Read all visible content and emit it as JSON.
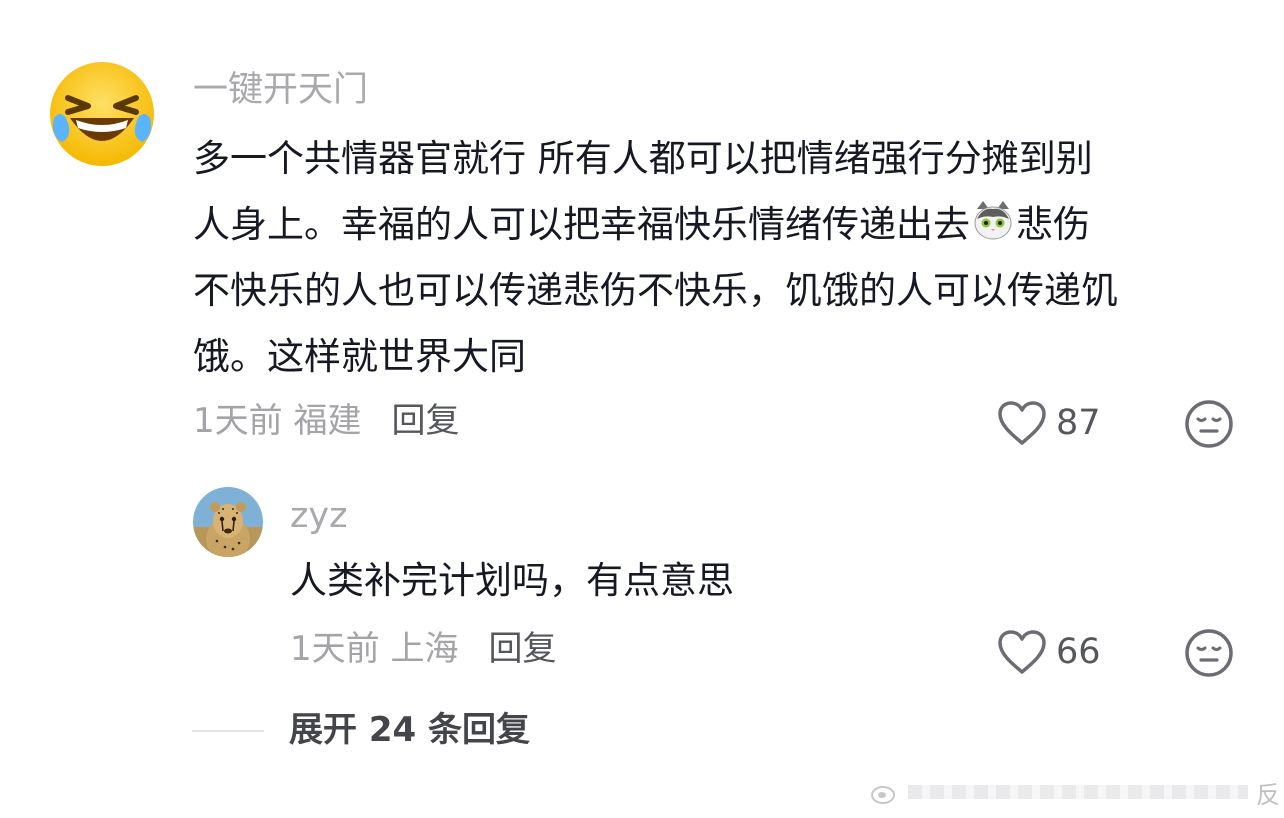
{
  "comment": {
    "username": "一键开天门",
    "text_lines": [
      "多一个共情器官就行  所有人都可以把情绪强行分摊到别",
      "人身上。幸福的人可以把幸福快乐情绪传递出去",
      "悲伤",
      "不快乐的人也可以传递悲伤不快乐，饥饿的人可以传递饥",
      "饿。这样就世界大同"
    ],
    "inline_emoji": "cat-emoji",
    "time_location": "1天前 福建",
    "reply_label": "回复",
    "likes": "87",
    "avatar": "laughing-crying-emoji"
  },
  "reply": {
    "username": "zyz",
    "text": "人类补完计划吗，有点意思",
    "time_location": "1天前 上海",
    "reply_label": "回复",
    "likes": "66",
    "avatar": "cheetah-photo"
  },
  "expand": {
    "label": "展开 24 条回复"
  },
  "watermark": {
    "text": "反"
  },
  "colors": {
    "primary_text": "#161823",
    "secondary_text": "#a9a9ad",
    "action_text": "#55575d"
  }
}
